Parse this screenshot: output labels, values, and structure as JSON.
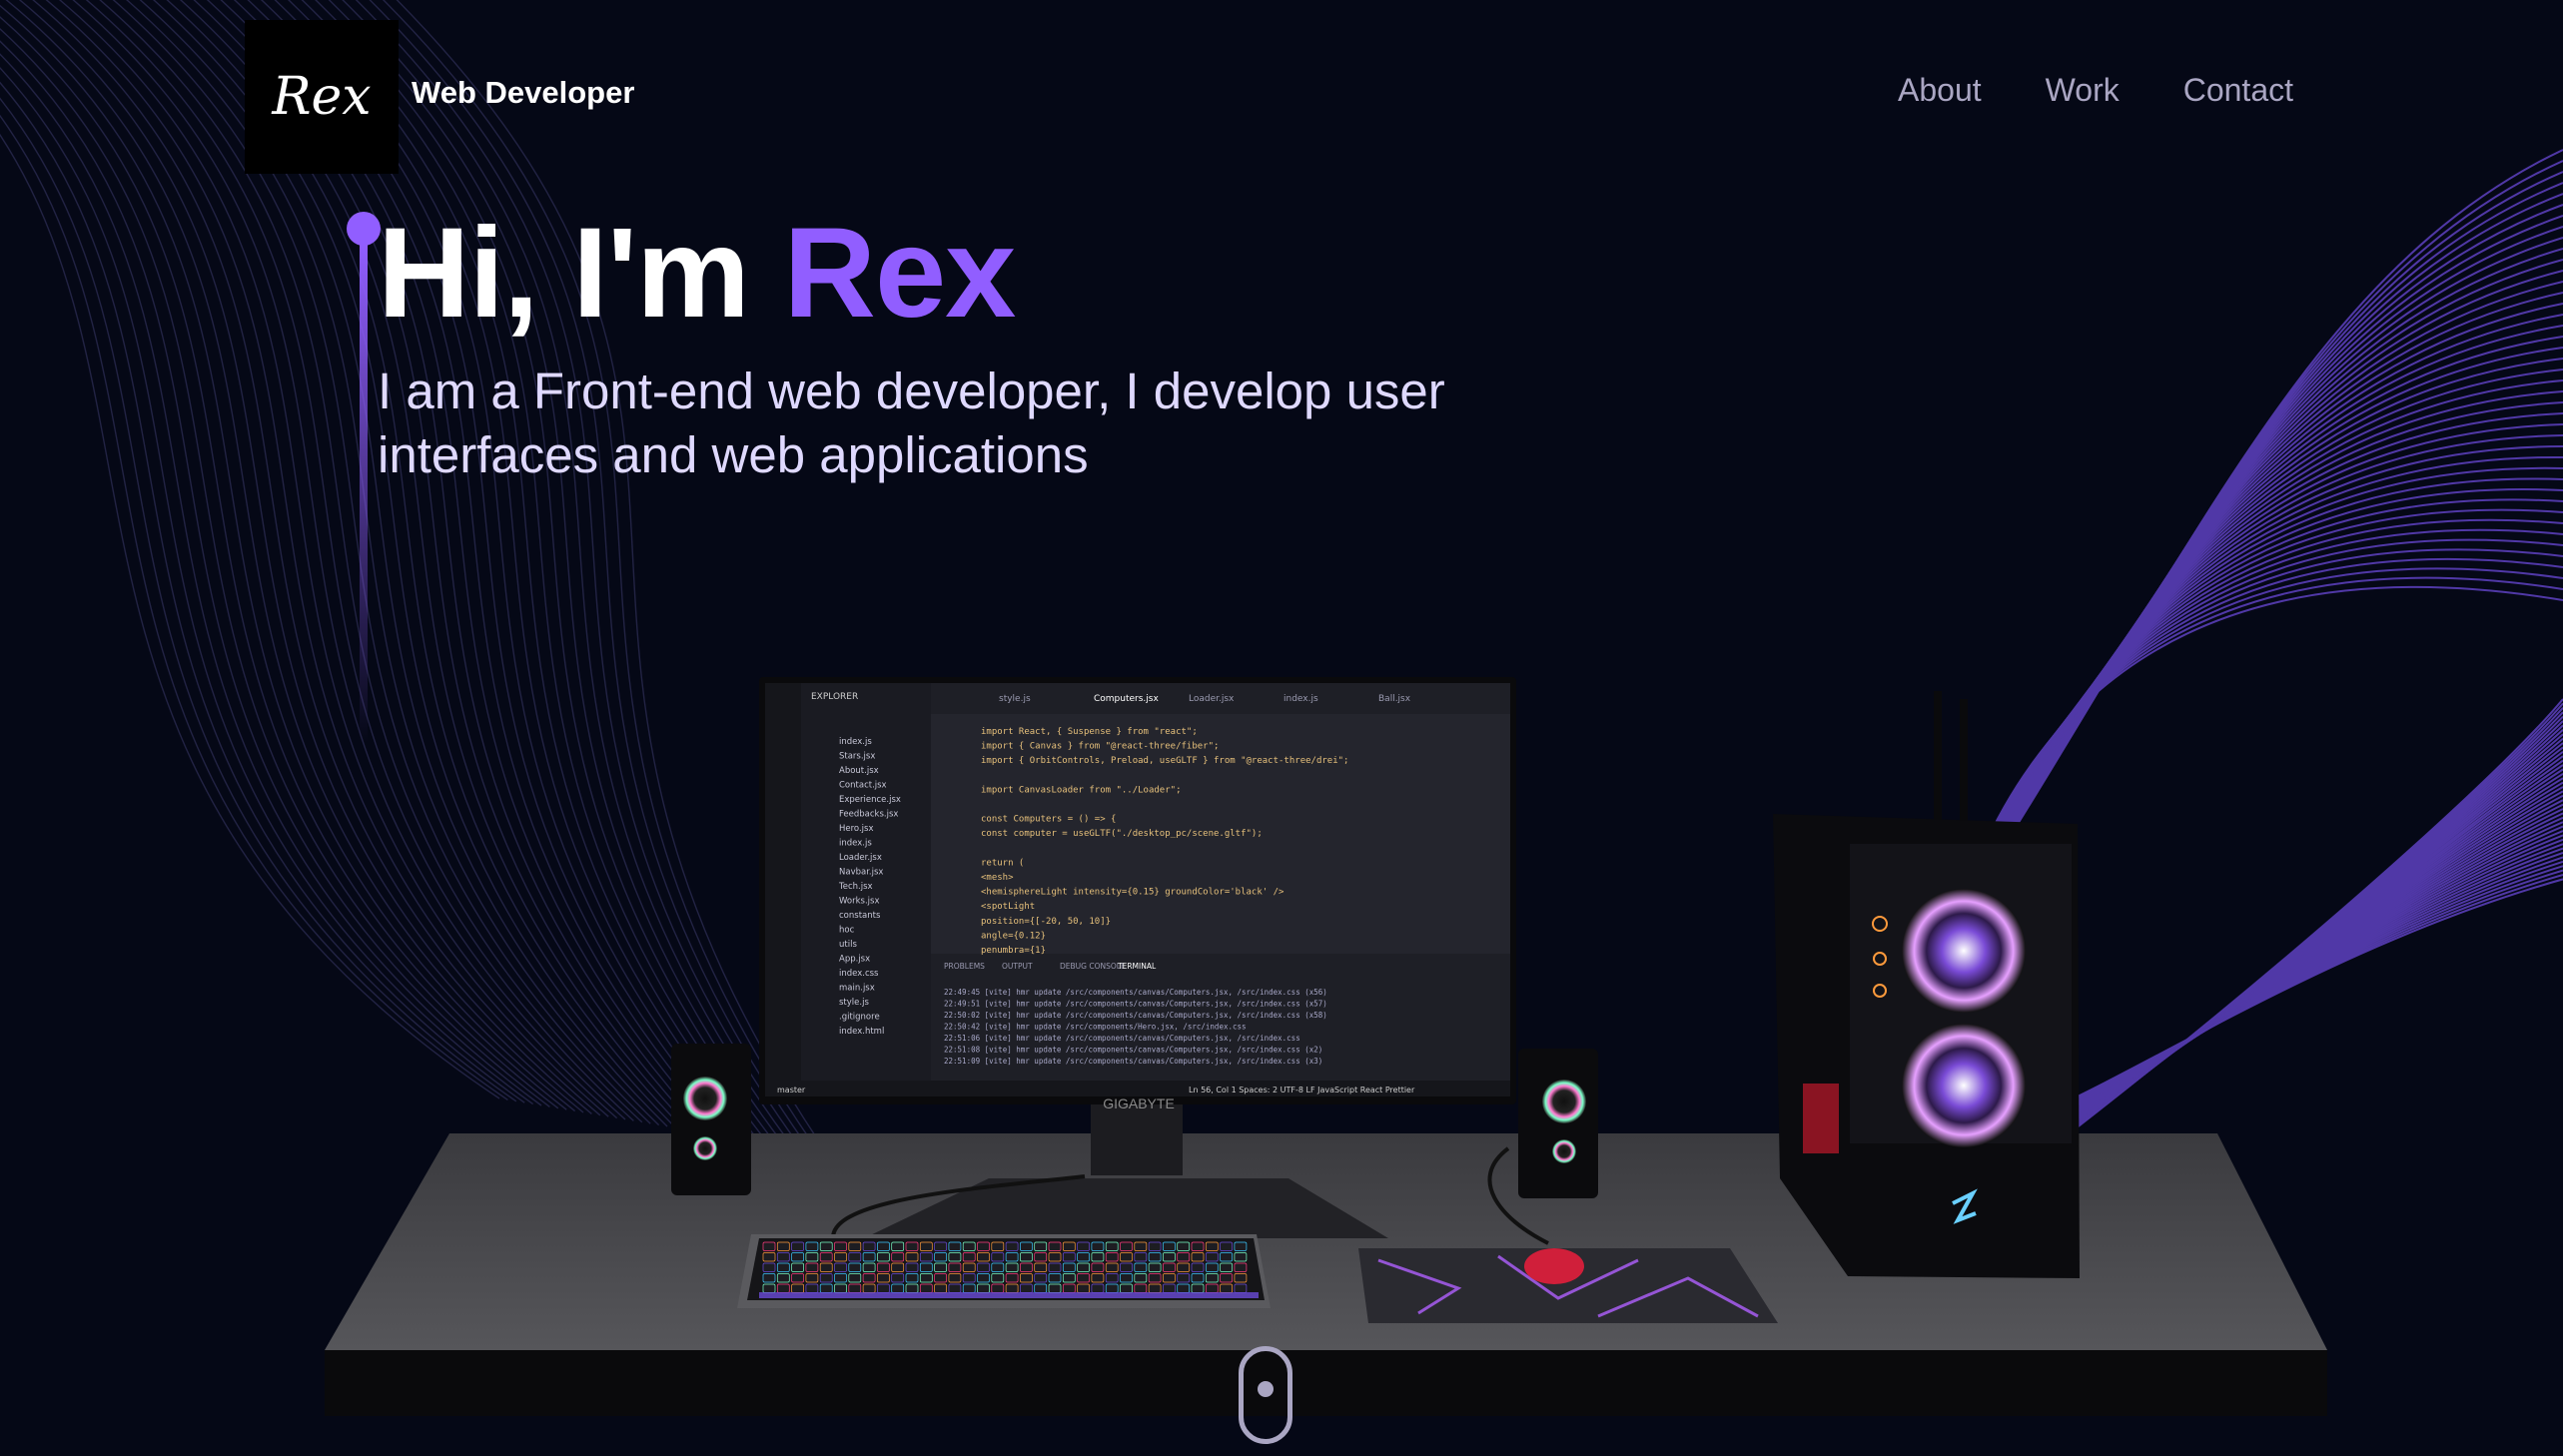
{
  "logo": {
    "text": "Rex"
  },
  "brand": {
    "title": "Web Developer"
  },
  "nav": {
    "links": [
      "About",
      "Work",
      "Contact"
    ]
  },
  "hero": {
    "greeting": "Hi, I'm ",
    "name": "Rex",
    "subtitle": "I am a Front-end web developer, I develop user interfaces and web applications"
  },
  "colors": {
    "background": "#050816",
    "accent": "#915eff",
    "nav_text": "#aaa6c3",
    "subtitle_text": "#dfd9ff"
  },
  "editor": {
    "tabs": [
      "style.js",
      "Computers.jsx",
      "Loader.jsx",
      "index.js",
      "Ball.jsx"
    ],
    "explorer_title": "EXPLORER",
    "files": [
      "index.js",
      "Stars.jsx",
      "About.jsx",
      "Contact.jsx",
      "Experience.jsx",
      "Feedbacks.jsx",
      "Hero.jsx",
      "index.js",
      "Loader.jsx",
      "Navbar.jsx",
      "Tech.jsx",
      "Works.jsx",
      "constants",
      "hoc",
      "utils",
      "App.jsx",
      "index.css",
      "main.jsx",
      "style.js",
      ".gitignore",
      "index.html"
    ],
    "code_lines": [
      "import React, { Suspense } from \"react\";",
      "import { Canvas } from \"@react-three/fiber\";",
      "import { OrbitControls, Preload, useGLTF } from \"@react-three/drei\";",
      "",
      "import CanvasLoader from \"../Loader\";",
      "",
      "const Computers = () => {",
      "  const computer = useGLTF(\"./desktop_pc/scene.gltf\");",
      "",
      "  return (",
      "    <mesh>",
      "      <hemisphereLight intensity={0.15} groundColor='black' />",
      "      <spotLight",
      "        position={[-20, 50, 10]}",
      "        angle={0.12}",
      "        penumbra={1}"
    ],
    "panel_tabs": [
      "PROBLEMS",
      "OUTPUT",
      "DEBUG CONSOLE",
      "TERMINAL"
    ],
    "terminal_lines": [
      "22:49:45 [vite] hmr update /src/components/canvas/Computers.jsx, /src/index.css (x56)",
      "22:49:51 [vite] hmr update /src/components/canvas/Computers.jsx, /src/index.css (x57)",
      "22:50:02 [vite] hmr update /src/components/canvas/Computers.jsx, /src/index.css (x58)",
      "22:50:42 [vite] hmr update /src/components/Hero.jsx, /src/index.css",
      "22:51:06 [vite] hmr update /src/components/canvas/Computers.jsx, /src/index.css",
      "22:51:08 [vite] hmr update /src/components/canvas/Computers.jsx, /src/index.css (x2)",
      "22:51:09 [vite] hmr update /src/components/canvas/Computers.jsx, /src/index.css (x3)"
    ],
    "status_left": "master",
    "status_right": "Ln 56, Col 1   Spaces: 2   UTF-8   LF   JavaScript React   Prettier"
  },
  "monitor": {
    "brand": "GIGABYTE"
  }
}
